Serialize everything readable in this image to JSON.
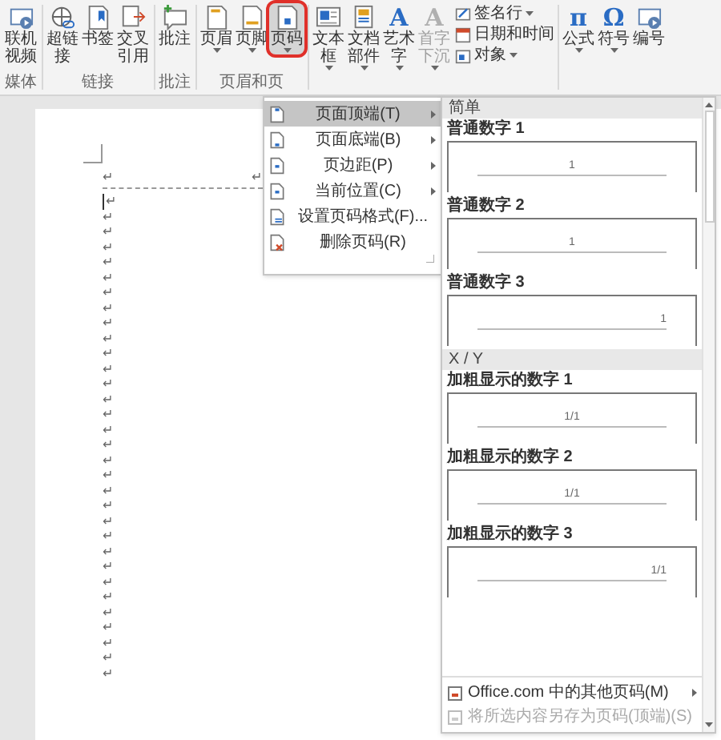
{
  "ribbon": {
    "groups": [
      {
        "label": "媒体",
        "buttons": [
          {
            "kind": "large",
            "label": "联机视频",
            "dropdown": false,
            "selected": false,
            "disabled": false
          }
        ]
      },
      {
        "label": "链接",
        "buttons": [
          {
            "kind": "large",
            "label": "超链接",
            "dropdown": false,
            "selected": false,
            "disabled": false
          },
          {
            "kind": "large",
            "label": "书签",
            "dropdown": false,
            "selected": false,
            "disabled": false
          },
          {
            "kind": "large",
            "label": "交叉引用",
            "dropdown": false,
            "selected": false,
            "disabled": false
          }
        ]
      },
      {
        "label": "批注",
        "buttons": [
          {
            "kind": "large",
            "label": "批注",
            "dropdown": false,
            "selected": false,
            "disabled": false
          }
        ]
      },
      {
        "label": "页眉和页",
        "buttons": [
          {
            "kind": "large",
            "label": "页眉",
            "dropdown": true,
            "selected": false,
            "disabled": false
          },
          {
            "kind": "large",
            "label": "页脚",
            "dropdown": true,
            "selected": false,
            "disabled": false
          },
          {
            "kind": "large",
            "label": "页码",
            "dropdown": true,
            "selected": true,
            "disabled": false
          }
        ]
      },
      {
        "buttons": [
          {
            "kind": "large",
            "label": "文本框",
            "dropdown": true,
            "selected": false,
            "disabled": false
          },
          {
            "kind": "large",
            "label": "文档部件",
            "dropdown": true,
            "selected": false,
            "disabled": false
          },
          {
            "kind": "large",
            "glyph": "A",
            "label": "艺术字",
            "dropdown": true,
            "selected": false,
            "disabled": false
          },
          {
            "kind": "large",
            "glyph": "A",
            "label": "首字下沉",
            "dropdown": true,
            "selected": false,
            "disabled": true
          },
          {
            "kind": "stack",
            "items": [
              {
                "label": "签名行",
                "dropdown": true
              },
              {
                "label": "日期和时间",
                "dropdown": false
              },
              {
                "label": "对象",
                "dropdown": true
              }
            ]
          }
        ]
      },
      {
        "buttons": [
          {
            "kind": "large",
            "glyph": "π",
            "label": "公式",
            "dropdown": true,
            "selected": false,
            "disabled": false
          },
          {
            "kind": "large",
            "glyph": "Ω",
            "label": "符号",
            "dropdown": true,
            "selected": false,
            "disabled": false
          },
          {
            "kind": "large",
            "label": "编号",
            "dropdown": false,
            "selected": false,
            "disabled": false
          }
        ]
      }
    ]
  },
  "page_number_menu": {
    "items": [
      {
        "label": "页面顶端(T)",
        "submenu": true,
        "selected": true,
        "disabled": false
      },
      {
        "label": "页面底端(B)",
        "submenu": true,
        "selected": false,
        "disabled": false
      },
      {
        "label": "页边距(P)",
        "submenu": true,
        "selected": false,
        "disabled": false
      },
      {
        "label": "当前位置(C)",
        "submenu": true,
        "selected": false,
        "disabled": false
      },
      {
        "label": "设置页码格式(F)...",
        "submenu": false,
        "selected": false,
        "disabled": false
      },
      {
        "label": "删除页码(R)",
        "submenu": false,
        "selected": false,
        "disabled": false
      }
    ]
  },
  "gallery": {
    "sections": [
      {
        "title": "简单",
        "items": [
          {
            "label": "普通数字 1",
            "number": "1",
            "kind": "centered"
          },
          {
            "label": "普通数字 2",
            "number": "1",
            "kind": "centered"
          },
          {
            "label": "普通数字 3",
            "number": "1",
            "kind": "right"
          }
        ]
      },
      {
        "title": "X / Y",
        "items": [
          {
            "label": "加粗显示的数字 1",
            "number": "1/1",
            "kind": "centered"
          },
          {
            "label": "加粗显示的数字 2",
            "number": "1/1",
            "kind": "centered"
          },
          {
            "label": "加粗显示的数字 3",
            "number": "1/1",
            "kind": "right"
          }
        ]
      }
    ],
    "footer": [
      {
        "label": "Office.com 中的其他页码(M)",
        "submenu": true,
        "disabled": false
      },
      {
        "label": "将所选内容另存为页码(顶端)(S)",
        "submenu": false,
        "disabled": true
      }
    ]
  },
  "document": {
    "header_marks": [
      "↵",
      "↵"
    ],
    "paragraph_marks": [
      "↵",
      "↵",
      "↵",
      "↵",
      "↵",
      "↵",
      "↵",
      "↵",
      "↵",
      "↵",
      "↵",
      "↵",
      "↵",
      "↵",
      "↵",
      "↵",
      "↵",
      "↵",
      "↵",
      "↵",
      "↵",
      "↵",
      "↵",
      "↵",
      "↵",
      "↵",
      "↵",
      "↵",
      "↵",
      "↵",
      "↵",
      "↵"
    ]
  }
}
